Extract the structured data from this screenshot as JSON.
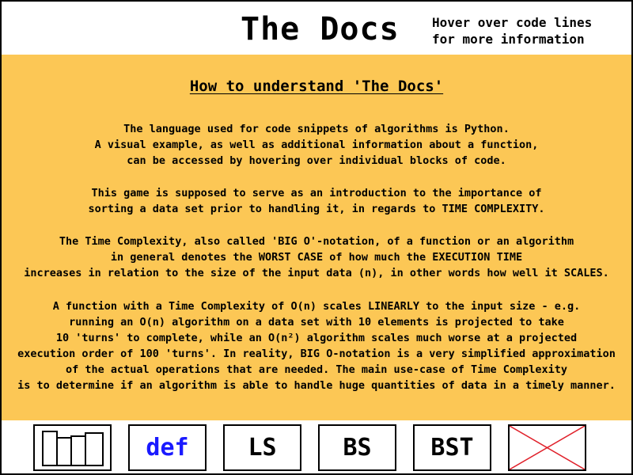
{
  "header": {
    "title": "The Docs",
    "hint_line1": "Hover over code lines",
    "hint_line2": "for more information"
  },
  "content": {
    "heading": "How to understand 'The Docs'",
    "paragraphs": [
      [
        "The language used for code snippets of algorithms is Python.",
        "A visual example, as well as additional information about a function,",
        "can be accessed by hovering over individual blocks of code."
      ],
      [
        "This game is supposed to serve as an introduction to the importance of",
        "sorting a data set prior to handling it, in regards to TIME COMPLEXITY."
      ],
      [
        "The Time Complexity, also called 'BIG O'-notation, of a function or an algorithm",
        "in general denotes the WORST CASE of how much the EXECUTION TIME",
        "increases in relation to the size of the input data (n), in other words how well it SCALES."
      ],
      [
        "A function with a Time Complexity of O(n) scales LINEARLY to the input size - e.g.",
        "running an O(n) algorithm on a data set with 10 elements is projected to take",
        "10 'turns' to complete, while an O(n²) algorithm scales much worse at a projected",
        "execution order of 100 'turns'. In reality, BIG O-notation is a very simplified approximation",
        "of the actual operations that are needed. The main use-case of Time Complexity",
        "is to determine if an algorithm is able to handle huge quantities of data in a timely manner."
      ]
    ]
  },
  "toolbar": {
    "bars_icon": "bar-chart-icon",
    "def_label": "def",
    "ls_label": "LS",
    "bs_label": "BS",
    "bst_label": "BST",
    "close_icon": "close-x-icon"
  },
  "colors": {
    "content_background": "#fcc755",
    "def_text": "#1a1aff",
    "close_cross": "#e0202a",
    "border": "#000000"
  }
}
